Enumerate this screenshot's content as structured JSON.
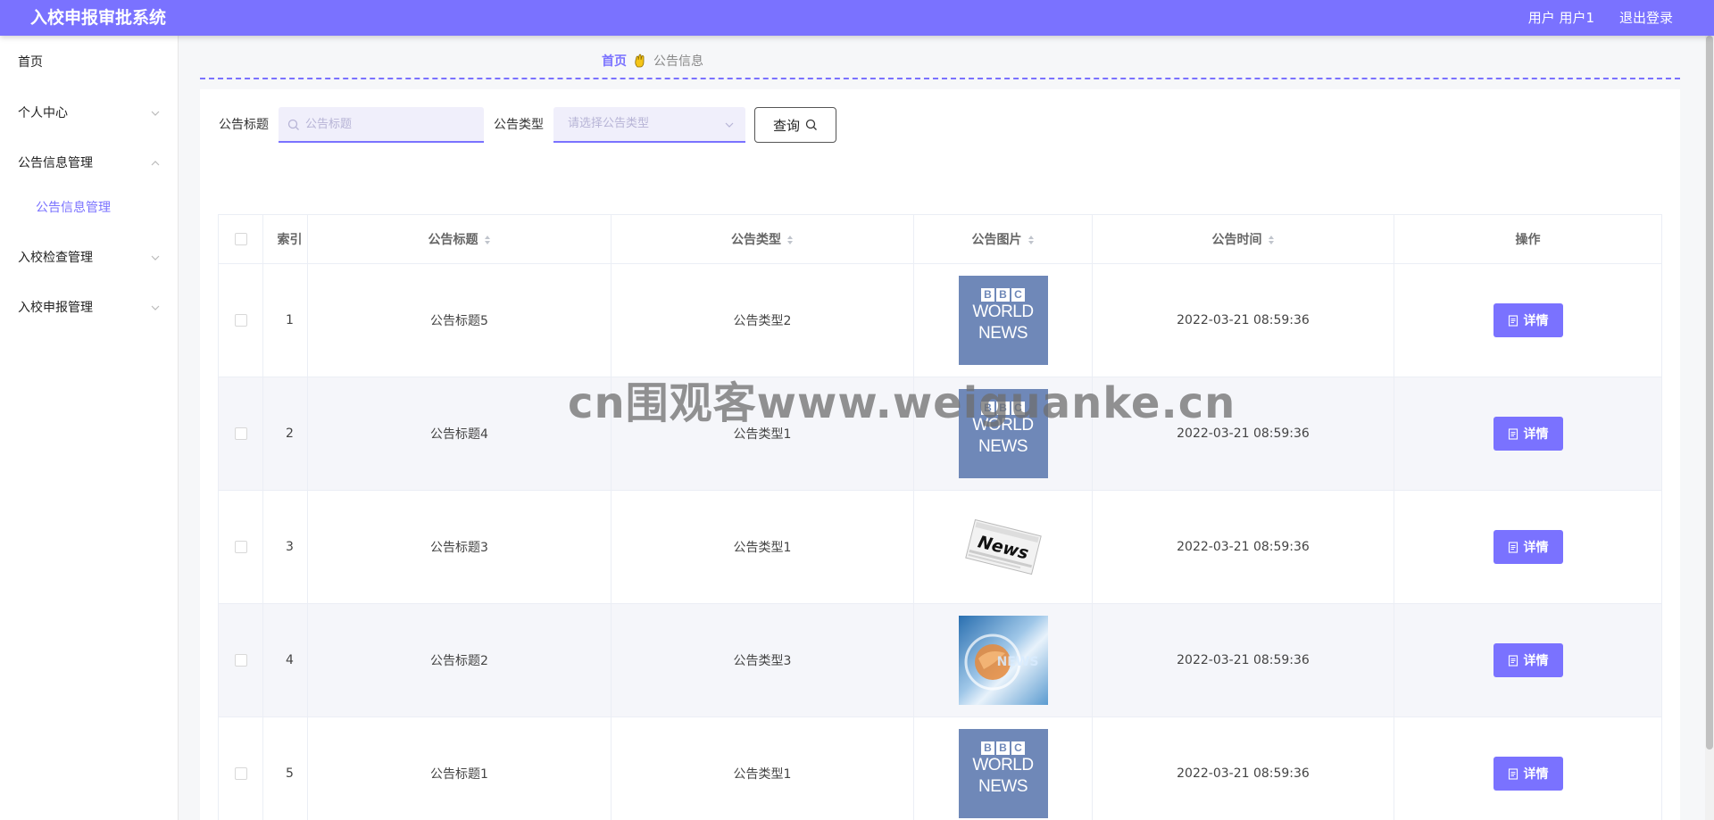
{
  "header": {
    "title": "入校申报审批系统",
    "user": "用户 用户1",
    "logout": "退出登录"
  },
  "sidebar": {
    "items": [
      {
        "label": "首页"
      },
      {
        "label": "个人中心"
      },
      {
        "label": "公告信息管理"
      },
      {
        "label": "入校检查管理"
      },
      {
        "label": "入校申报管理"
      }
    ],
    "sub_item": "公告信息管理"
  },
  "breadcrumb": {
    "home": "首页",
    "current": "公告信息"
  },
  "search": {
    "title_label": "公告标题",
    "title_placeholder": "公告标题",
    "type_label": "公告类型",
    "type_placeholder": "请选择公告类型",
    "query_button": "查询"
  },
  "table": {
    "headers": {
      "index": "索引",
      "title": "公告标题",
      "type": "公告类型",
      "image": "公告图片",
      "time": "公告时间",
      "action": "操作"
    },
    "detail_label": "详情",
    "rows": [
      {
        "index": "1",
        "title": "公告标题5",
        "type": "公告类型2",
        "image": "bbc-world-news",
        "time": "2022-03-21 08:59:36"
      },
      {
        "index": "2",
        "title": "公告标题4",
        "type": "公告类型1",
        "image": "bbc-world-news",
        "time": "2022-03-21 08:59:36"
      },
      {
        "index": "3",
        "title": "公告标题3",
        "type": "公告类型1",
        "image": "newspaper-news",
        "time": "2022-03-21 08:59:36"
      },
      {
        "index": "4",
        "title": "公告标题2",
        "type": "公告类型3",
        "image": "globe-news",
        "time": "2022-03-21 08:59:36"
      },
      {
        "index": "5",
        "title": "公告标题1",
        "type": "公告类型1",
        "image": "bbc-world-news",
        "time": "2022-03-21 08:59:36"
      }
    ]
  },
  "image_text": {
    "bbc": [
      "B",
      "B",
      "C"
    ],
    "world": "WORLD",
    "news": "NEWS",
    "newspaper": "News"
  },
  "watermark": "cn围观客www.weiguanke.cn",
  "colors": {
    "accent": "#7a72ff"
  }
}
